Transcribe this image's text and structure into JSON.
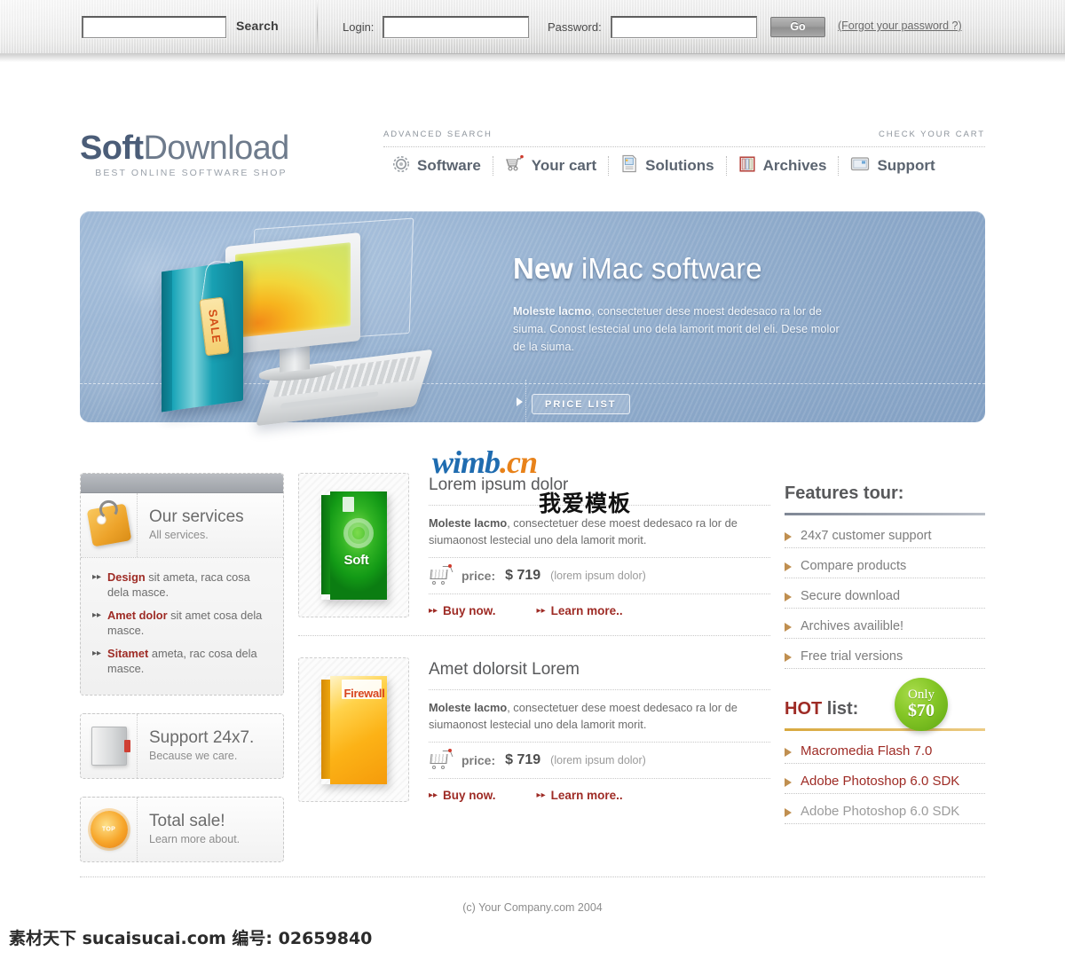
{
  "topbar": {
    "search_button_label": "Search",
    "search_value": "",
    "search_placeholder": "",
    "login_label": "Login:",
    "login_value": "",
    "password_label": "Password:",
    "password_value": "",
    "go_label": "Go",
    "forgot_label": "(Forgot your password ?)"
  },
  "header": {
    "logo_bold": "Soft",
    "logo_light": "Download",
    "tagline": "BEST ONLINE SOFTWARE SHOP",
    "advanced_search": "ADVANCED SEARCH",
    "check_your_cart": "CHECK YOUR CART",
    "nav": [
      {
        "label": "Software",
        "icon": "gear-icon"
      },
      {
        "label": "Your cart",
        "icon": "cart-icon"
      },
      {
        "label": "Solutions",
        "icon": "document-icon"
      },
      {
        "label": "Archives",
        "icon": "books-icon"
      },
      {
        "label": "Support",
        "icon": "monitor-icon"
      }
    ]
  },
  "banner": {
    "title_bold": "New",
    "title_light": "iMac software",
    "body_bold": "Moleste lacmo",
    "body_text": ", consectetuer dese moest dedesaco ra lor de siuma. Conost lestecial uno dela lamorit morit del eli. Dese molor de la siuma.",
    "button_label": "PRICE LIST",
    "art_tag_label": "SALE"
  },
  "services_panel": {
    "title": "Our services",
    "subtitle": "All services.",
    "icon": "price-tag-icon",
    "items": [
      {
        "strong": "Design",
        "rest": " sit ameta, raca cosa dela masce."
      },
      {
        "strong": "Amet dolor",
        "rest": " sit amet cosa dela masce."
      },
      {
        "strong": "Sitamet",
        "rest": " ameta, rac cosa dela masce."
      }
    ]
  },
  "side_panels": [
    {
      "title": "Support 24x7.",
      "subtitle": "Because we care.",
      "icon": "door-icon"
    },
    {
      "title": "Total sale!",
      "subtitle": "Learn more about.",
      "icon": "sunburst-icon",
      "badge_text": "TOP"
    }
  ],
  "products": [
    {
      "title": "Lorem ipsum dolor",
      "desc_bold": "Moleste lacmo",
      "desc_text": ", consectetuer dese moest dedesaco ra lor de siumaonost lestecial uno dela lamorit morit.",
      "price_label": "price:",
      "price_value": "$ 719",
      "price_note": "(lorem ipsum dolor)",
      "buy_label": "Buy now.",
      "learn_label": "Learn more..",
      "box_title": "Soft",
      "box_color": "#1faa2a"
    },
    {
      "title": "Amet dolorsit Lorem",
      "desc_bold": "Moleste lacmo",
      "desc_text": ", consectetuer dese moest dedesaco ra lor de siumaonost lestecial uno dela lamorit morit.",
      "price_label": "price:",
      "price_value": "$ 719",
      "price_note": "(lorem ipsum dolor)",
      "buy_label": "Buy now.",
      "learn_label": "Learn more..",
      "box_title": "Firewall",
      "box_color": "#f7b318"
    }
  ],
  "features": {
    "title": "Features tour:",
    "items": [
      "24x7 customer support",
      "Compare products",
      "Secure download",
      "Archives availible!",
      "Free trial versions"
    ]
  },
  "hot": {
    "title_accent": "HOT",
    "title_rest": " list:",
    "badge_line1": "Only",
    "badge_line2": "$70",
    "badge_color": "#7ec22a",
    "items": [
      {
        "label": "Macromedia Flash 7.0",
        "highlight": true
      },
      {
        "label": "Adobe Photoshop 6.0 SDK",
        "highlight": true
      },
      {
        "label": "Adobe Photoshop 6.0 SDK",
        "highlight": false
      }
    ]
  },
  "footer": {
    "copyright": "(c) Your Company.com 2004"
  },
  "watermarks": {
    "wimb_a": "wimb",
    "wimb_b": ".cn",
    "wimb_cn": "我爱模板",
    "bottom": "素材天下 sucaisucai.com  编号: 02659840"
  }
}
